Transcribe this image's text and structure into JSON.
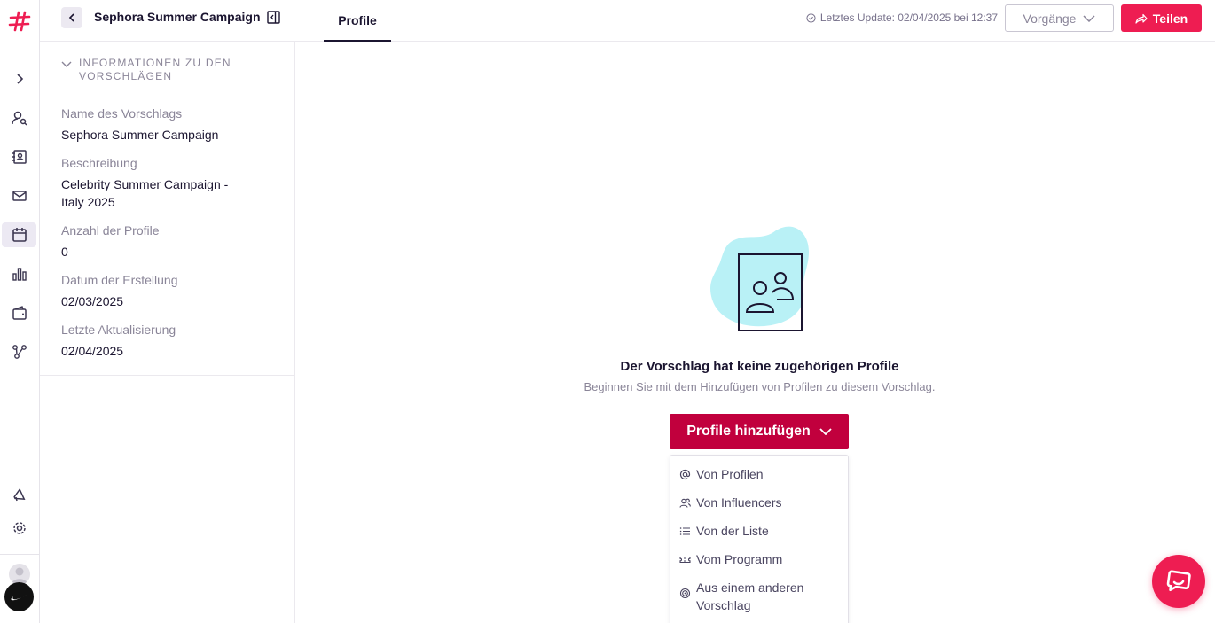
{
  "header": {
    "title": "Sephora Summer Campaign",
    "tab_profile": "Profile",
    "last_update": "Letztes Update: 02/04/2025 bei 12:37",
    "processes_label": "Vorgänge",
    "share_label": "Teilen"
  },
  "info": {
    "section_title": "INFORMATIONEN ZU DEN VORSCHLÄGEN",
    "fields": [
      {
        "label": "Name des Vorschlags",
        "value": "Sephora Summer Campaign"
      },
      {
        "label": "Beschreibung",
        "value": "Celebrity Summer Campaign - Italy 2025"
      },
      {
        "label": "Anzahl der Profile",
        "value": "0"
      },
      {
        "label": "Datum der Erstellung",
        "value": "02/03/2025"
      },
      {
        "label": "Letzte Aktualisierung",
        "value": "02/04/2025"
      }
    ]
  },
  "empty_state": {
    "title": "Der Vorschlag hat keine zugehörigen Profile",
    "subtitle": "Beginnen Sie mit dem Hinzufügen von Profilen zu diesem Vorschlag.",
    "add_button": "Profile hinzufügen"
  },
  "menu": {
    "items": [
      {
        "label": "Von Profilen",
        "icon": "at-icon"
      },
      {
        "label": "Von Influencers",
        "icon": "users-icon"
      },
      {
        "label": "Von der Liste",
        "icon": "list-icon"
      },
      {
        "label": "Vom Programm",
        "icon": "ticket-icon"
      },
      {
        "label": "Aus einem anderen Vorschlag",
        "icon": "target-icon"
      }
    ]
  },
  "colors": {
    "accent": "#ee1d52",
    "primary_button": "#c1003d",
    "illustration_blob": "#b9f1f6"
  }
}
